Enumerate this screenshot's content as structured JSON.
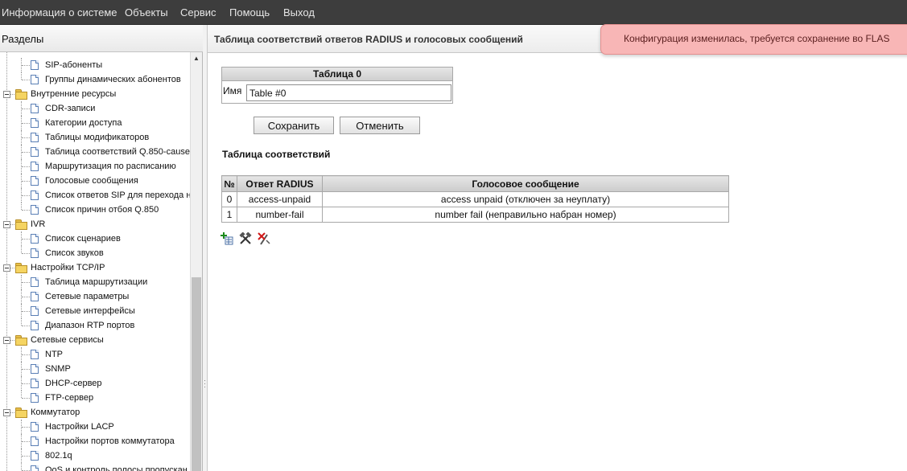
{
  "menu": [
    "Информация о системе",
    "Объекты",
    "Сервис",
    "Помощь",
    "Выход"
  ],
  "left_panel": {
    "title": "Разделы",
    "tree": [
      {
        "label": "SIP-абоненты",
        "type": "doc",
        "level": 2
      },
      {
        "label": "Группы динамических абонентов",
        "type": "doc",
        "level": 2
      },
      {
        "label": "Внутренние ресурсы",
        "type": "folder",
        "level": 1
      },
      {
        "label": "CDR-записи",
        "type": "doc",
        "level": 2
      },
      {
        "label": "Категории доступа",
        "type": "doc",
        "level": 2
      },
      {
        "label": "Таблицы модификаторов",
        "type": "doc",
        "level": 2
      },
      {
        "label": "Таблица соответствий Q.850-cause",
        "type": "doc",
        "level": 2
      },
      {
        "label": "Маршрутизация по расписанию",
        "type": "doc",
        "level": 2
      },
      {
        "label": "Голосовые сообщения",
        "type": "doc",
        "level": 2
      },
      {
        "label": "Список ответов SIP для перехода н",
        "type": "doc",
        "level": 2
      },
      {
        "label": "Список причин отбоя Q.850",
        "type": "doc",
        "level": 2
      },
      {
        "label": "IVR",
        "type": "folder",
        "level": 1
      },
      {
        "label": "Список сценариев",
        "type": "doc",
        "level": 2
      },
      {
        "label": "Список звуков",
        "type": "doc",
        "level": 2
      },
      {
        "label": "Настройки TCP/IP",
        "type": "folder",
        "level": 1
      },
      {
        "label": "Таблица маршрутизации",
        "type": "doc",
        "level": 2
      },
      {
        "label": "Сетевые параметры",
        "type": "doc",
        "level": 2
      },
      {
        "label": "Сетевые интерфейсы",
        "type": "doc",
        "level": 2
      },
      {
        "label": "Диапазон RTP портов",
        "type": "doc",
        "level": 2
      },
      {
        "label": "Сетевые сервисы",
        "type": "folder",
        "level": 1
      },
      {
        "label": "NTP",
        "type": "doc",
        "level": 2
      },
      {
        "label": "SNMP",
        "type": "doc",
        "level": 2
      },
      {
        "label": "DHCP-сервер",
        "type": "doc",
        "level": 2
      },
      {
        "label": "FTP-сервер",
        "type": "doc",
        "level": 2
      },
      {
        "label": "Коммутатор",
        "type": "folder",
        "level": 1
      },
      {
        "label": "Настройки LACP",
        "type": "doc",
        "level": 2
      },
      {
        "label": "Настройки портов коммутатора",
        "type": "doc",
        "level": 2
      },
      {
        "label": "802.1q",
        "type": "doc",
        "level": 2
      },
      {
        "label": "QoS и контроль полосы пропускан",
        "type": "doc",
        "level": 2
      }
    ]
  },
  "main": {
    "header": "Таблица соответствий ответов RADIUS и голосовых сообщений",
    "notification": "Конфигурация изменилась, требуется сохранение во FLAS",
    "form": {
      "title": "Таблица 0",
      "name_label": "Имя",
      "name_value": "Table #0"
    },
    "buttons": {
      "save": "Сохранить",
      "cancel": "Отменить"
    },
    "section_title": "Таблица соответствий",
    "table": {
      "headers": [
        "№",
        "Ответ RADIUS",
        "Голосовое сообщение"
      ],
      "rows": [
        [
          "0",
          "access-unpaid",
          "access unpaid (отключен за неуплату)"
        ],
        [
          "1",
          "number-fail",
          "number fail (неправильно набран номер)"
        ]
      ]
    },
    "tools": [
      "add-icon",
      "edit-icon",
      "delete-icon"
    ]
  },
  "colors": {
    "menubar": "#3d3d3d",
    "notification_bg": "#f8b6b6",
    "folder": "#f5d462"
  }
}
